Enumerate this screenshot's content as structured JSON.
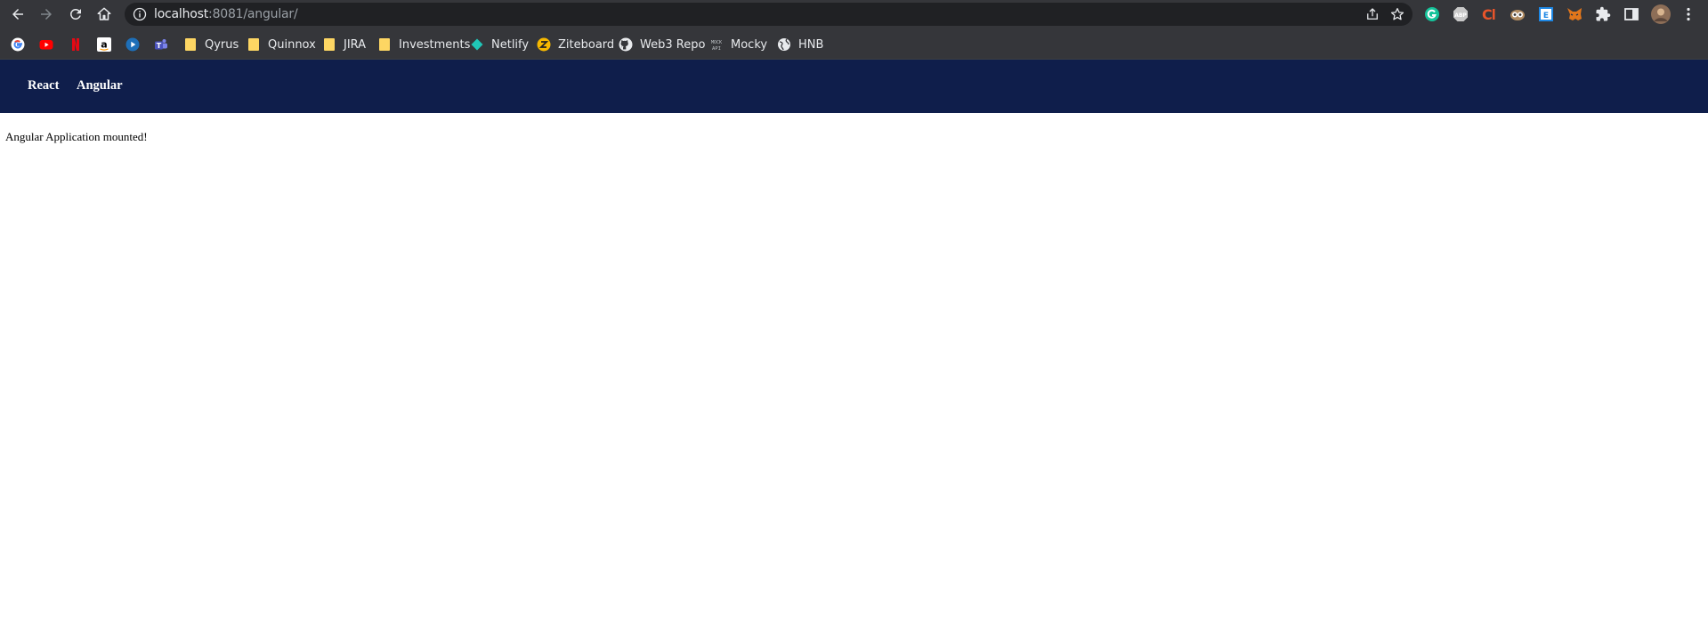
{
  "browser": {
    "url_host": "localhost",
    "url_path": ":8081/angular/",
    "bookmarks": [
      {
        "label": "Qyrus",
        "icon": "folder-icon"
      },
      {
        "label": "Quinnox",
        "icon": "folder-icon"
      },
      {
        "label": "JIRA",
        "icon": "folder-icon"
      },
      {
        "label": "Investments",
        "icon": "folder-icon"
      },
      {
        "label": "Netlify",
        "icon": "netlify-icon"
      },
      {
        "label": "Ziteboard",
        "icon": "ziteboard-icon"
      },
      {
        "label": "Web3 Repo",
        "icon": "github-icon"
      },
      {
        "label": "Mocky",
        "icon": "mocky-icon"
      },
      {
        "label": "HNB",
        "icon": "globe-icon"
      }
    ],
    "icon_bookmarks": [
      "google-icon",
      "youtube-icon",
      "netflix-icon",
      "amazon-icon",
      "play-icon",
      "teams-icon"
    ],
    "extensions": [
      "grammarly-icon",
      "adblock-icon",
      "clockify-icon",
      "owl-icon",
      "bookmark-ext-icon",
      "metamask-icon",
      "puzzle-icon",
      "sidepanel-icon",
      "profile-avatar"
    ]
  },
  "nav": {
    "react_label": "React",
    "angular_label": "Angular"
  },
  "page": {
    "message": "Angular Application mounted!"
  },
  "colors": {
    "chrome_bg": "#35363a",
    "omnibox_bg": "#202124",
    "nav_bg": "#0f1e4b",
    "page_bg": "#ffffff"
  }
}
